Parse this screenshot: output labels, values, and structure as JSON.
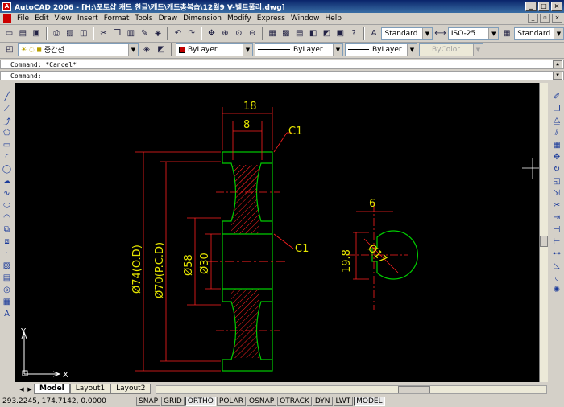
{
  "window": {
    "title": "AutoCAD 2006 - [H:\\포토샵 캐드 한글\\캐드\\캐드총복습\\12월9 V-벨트풀리.dwg]",
    "controls": [
      "_",
      "□",
      "×"
    ]
  },
  "menu": {
    "items": [
      "File",
      "Edit",
      "View",
      "Insert",
      "Format",
      "Tools",
      "Draw",
      "Dimension",
      "Modify",
      "Express",
      "Window",
      "Help"
    ]
  },
  "styles_toolbar": {
    "text_style": "Standard",
    "dim_style": "ISO-25",
    "table_style": "Standard"
  },
  "layers_toolbar": {
    "layer_name": "중간선",
    "color": "ByLayer",
    "linetype": "ByLayer",
    "lineweight": "ByLayer",
    "plot_style": "ByColor"
  },
  "command": {
    "history": "Command: *Cancel*",
    "prompt": "Command:"
  },
  "drawing": {
    "dims": {
      "width_18": "18",
      "width_8": "8",
      "chamfer_top": "C1",
      "chamfer_mid": "C1",
      "dia_74": "Ø74(O.D)",
      "dia_70": "Ø70(P.C.D)",
      "dia_58": "Ø58",
      "dia_30": "Ø30",
      "key_6": "6",
      "key_198": "19.8",
      "key_dia17": "Ø17"
    },
    "ucs": {
      "y": "Y",
      "x": "X"
    },
    "colors": {
      "outline": "#00cc00",
      "dimension": "#ff2020",
      "text": "#e6e600",
      "hatch": "#ff2020",
      "center": "#ff2020"
    }
  },
  "layout_tabs": [
    "Model",
    "Layout1",
    "Layout2"
  ],
  "status": {
    "coords": "293.2245, 174.7142, 0.0000",
    "toggles": [
      "SNAP",
      "GRID",
      "ORTHO",
      "POLAR",
      "OSNAP",
      "OTRACK",
      "DYN",
      "LWT",
      "MODEL"
    ]
  }
}
